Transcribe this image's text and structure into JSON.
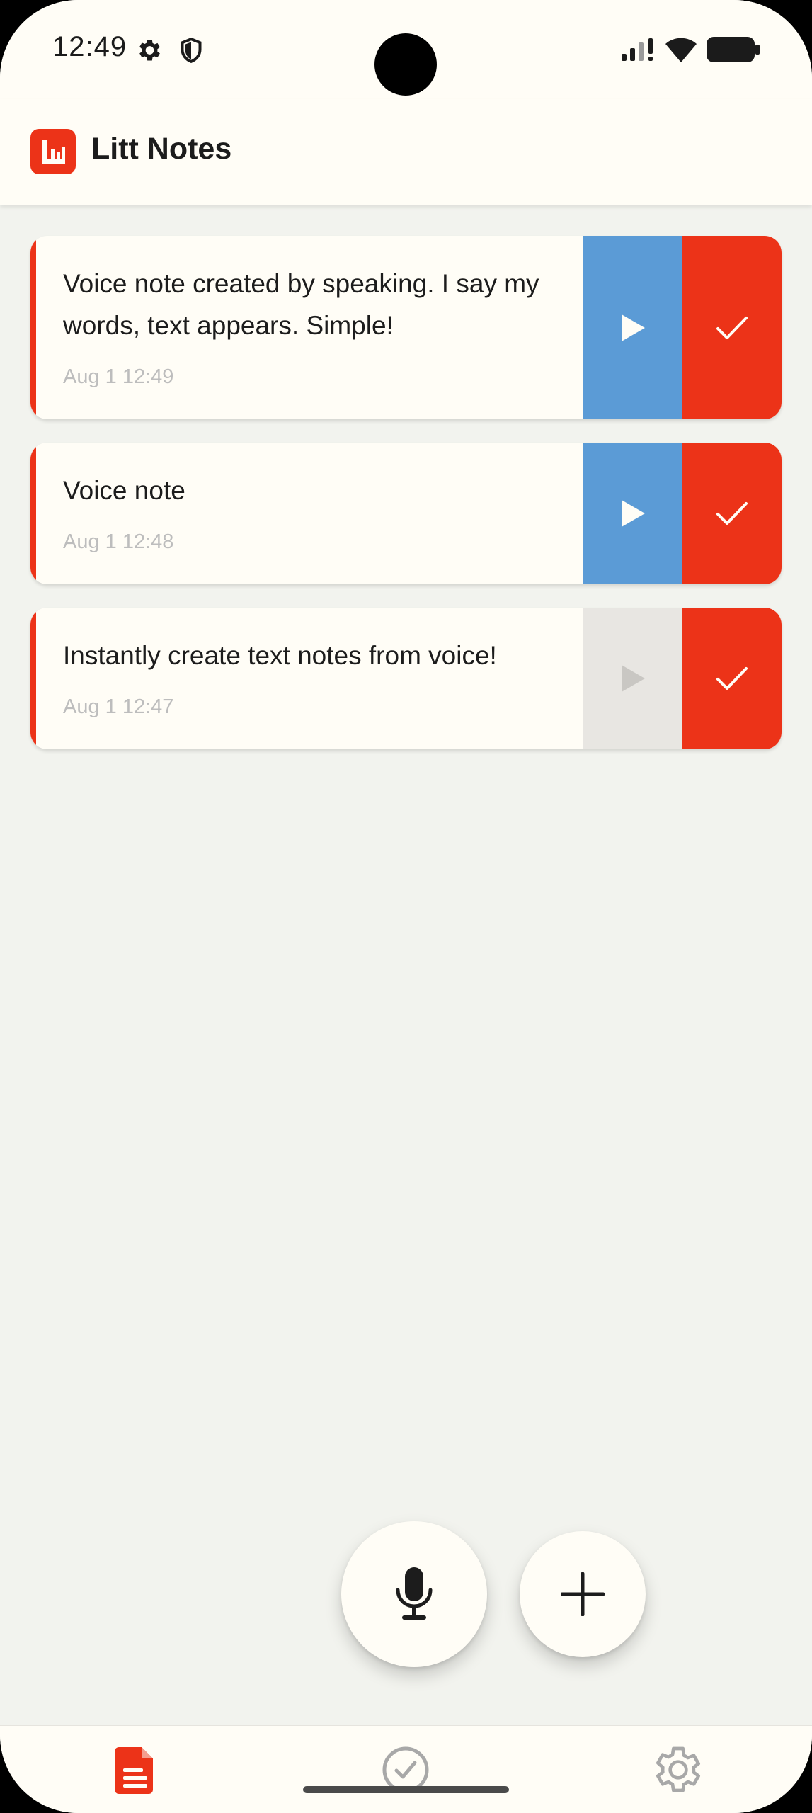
{
  "status_bar": {
    "time": "12:49",
    "icons": [
      "settings-icon",
      "shield-icon",
      "signal-icon",
      "wifi-icon",
      "battery-icon"
    ]
  },
  "app_bar": {
    "title": "Litt Notes",
    "logo_icon": "chart-bars-icon"
  },
  "notes": [
    {
      "text": "Voice note created by speaking. I say my words, text appears. Simple!",
      "date": "Aug 1 12:49",
      "has_audio": true
    },
    {
      "text": "Voice note",
      "date": "Aug 1 12:48",
      "has_audio": true
    },
    {
      "text": "Instantly create text notes from voice!",
      "date": "Aug 1 12:47",
      "has_audio": false
    }
  ],
  "actions": {
    "mic_icon": "microphone-icon",
    "add_icon": "plus-icon"
  },
  "bottom_nav": {
    "items": [
      {
        "icon": "document-icon",
        "active": true
      },
      {
        "icon": "check-circle-icon",
        "active": false
      },
      {
        "icon": "gear-icon",
        "active": false
      }
    ]
  },
  "colors": {
    "accent": "#ec3318",
    "play": "#5b9bd6",
    "play_disabled": "#e8e6e2",
    "surface": "#fffdf6",
    "background": "#f2f3ee"
  }
}
